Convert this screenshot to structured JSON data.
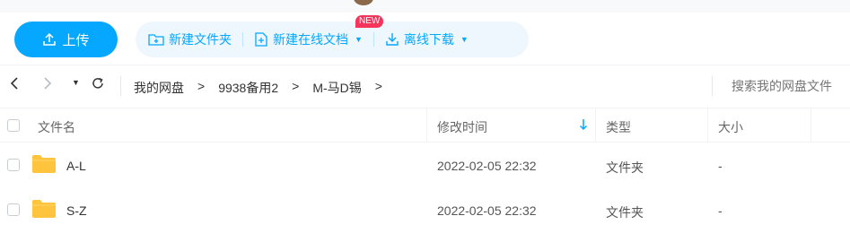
{
  "toolbar": {
    "upload_label": "上传",
    "new_folder_label": "新建文件夹",
    "new_online_doc_label": "新建在线文档",
    "new_badge": "NEW",
    "offline_download_label": "离线下载"
  },
  "nav": {
    "breadcrumb": [
      "我的网盘",
      "9938备用2",
      "M-马D锡"
    ],
    "search_placeholder": "搜索我的网盘文件"
  },
  "table": {
    "columns": {
      "name": "文件名",
      "modified": "修改时间",
      "type": "类型",
      "size": "大小"
    },
    "rows": [
      {
        "name": "A-L",
        "modified": "2022-02-05 22:32",
        "type": "文件夹",
        "size": "-"
      },
      {
        "name": "S-Z",
        "modified": "2022-02-05 22:32",
        "type": "文件夹",
        "size": "-"
      }
    ]
  },
  "colors": {
    "accent": "#06a7ff",
    "badge": "#f5345c",
    "folder": "#ffc43d"
  },
  "icons": [
    "upload-icon",
    "folder-plus-icon",
    "online-doc-icon",
    "download-icon",
    "back-icon",
    "forward-icon",
    "dropdown-icon",
    "refresh-icon",
    "sort-down-icon",
    "folder-icon"
  ]
}
